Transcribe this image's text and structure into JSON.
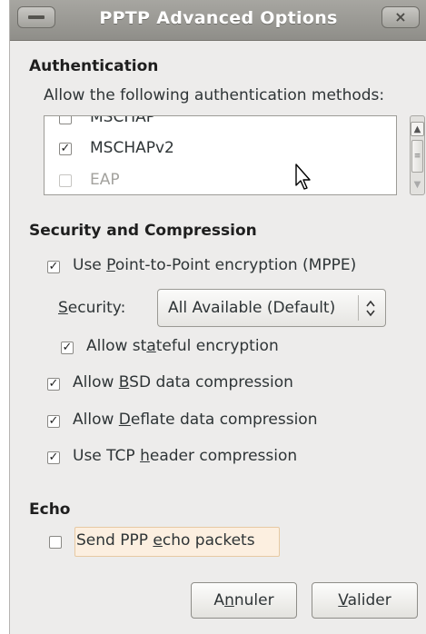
{
  "window": {
    "title": "PPTP Advanced Options",
    "close_glyph": "×"
  },
  "authentication": {
    "heading": "Authentication",
    "description": "Allow the following authentication methods:",
    "methods": [
      {
        "label": "MSCHAP",
        "checked": false,
        "enabled": true
      },
      {
        "label": "MSCHAPv2",
        "checked": true,
        "enabled": true
      },
      {
        "label": "EAP",
        "checked": false,
        "enabled": false
      }
    ]
  },
  "security": {
    "heading": "Security and Compression",
    "mppe": {
      "pre": "Use ",
      "mn": "P",
      "post": "oint-to-Point encryption (MPPE)",
      "checked": true
    },
    "security_label": {
      "mn": "S",
      "post": "ecurity:"
    },
    "security_value": "All Available (Default)",
    "stateful": {
      "pre": "Allow st",
      "mn": "a",
      "post": "teful encryption",
      "checked": true
    },
    "bsd": {
      "pre": "Allow ",
      "mn": "B",
      "post": "SD data compression",
      "checked": true
    },
    "deflate": {
      "pre": "Allow ",
      "mn": "D",
      "post": "eflate data compression",
      "checked": true
    },
    "tcp": {
      "pre": "Use TCP ",
      "mn": "h",
      "post": "eader compression",
      "checked": true
    }
  },
  "echo": {
    "heading": "Echo",
    "send": {
      "pre": "Send PPP ",
      "mn": "e",
      "post": "cho packets",
      "checked": false
    }
  },
  "buttons": {
    "cancel": {
      "pre": "A",
      "mn": "n",
      "post": "nuler"
    },
    "ok": {
      "pre": "",
      "mn": "V",
      "post": "alider"
    }
  },
  "icons": {
    "check": "✓",
    "arrow_up": "▲",
    "arrow_down": "▼",
    "thumb_grip": "≡",
    "combo": "⌃⌄"
  }
}
